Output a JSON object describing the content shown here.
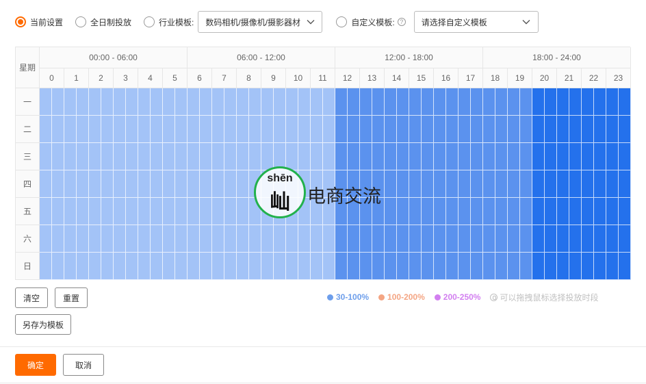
{
  "options": {
    "current": "当前设置",
    "fullday": "全日制投放",
    "industry": "行业模板:",
    "industry_select": "数码相机/摄像机/摄影器材",
    "custom": "自定义模板:",
    "custom_select": "请选择自定义模板"
  },
  "grid": {
    "corner": "星期",
    "groups": [
      "00:00 - 06:00",
      "06:00 - 12:00",
      "12:00 - 18:00",
      "18:00 - 24:00"
    ],
    "hours": [
      "0",
      "1",
      "2",
      "3",
      "4",
      "5",
      "6",
      "7",
      "8",
      "9",
      "10",
      "11",
      "12",
      "13",
      "14",
      "15",
      "16",
      "17",
      "18",
      "19",
      "20",
      "21",
      "22",
      "23"
    ],
    "days": [
      "一",
      "二",
      "三",
      "四",
      "五",
      "六",
      "日"
    ],
    "hour_levels": [
      1,
      1,
      1,
      1,
      1,
      1,
      1,
      1,
      1,
      1,
      1,
      1,
      2,
      2,
      2,
      2,
      2,
      2,
      2,
      2,
      3,
      3,
      3,
      3
    ],
    "level_colors": {
      "1": "#a3c3f7",
      "2": "#5b92ee",
      "3": "#2471ec"
    }
  },
  "watermark": {
    "pinyin": "shēn",
    "char": "屾",
    "text": "电商交流"
  },
  "buttons": {
    "clear": "清空",
    "reset": "重置",
    "save_template": "另存为模板",
    "confirm": "确定",
    "cancel": "取消"
  },
  "legend": {
    "items": [
      {
        "label": "30-100%",
        "color": "#6d9eeb"
      },
      {
        "label": "100-200%",
        "color": "#f4a583"
      },
      {
        "label": "200-250%",
        "color": "#d27ff0"
      }
    ],
    "hint": "可以拖拽鼠标选择投放时段"
  }
}
